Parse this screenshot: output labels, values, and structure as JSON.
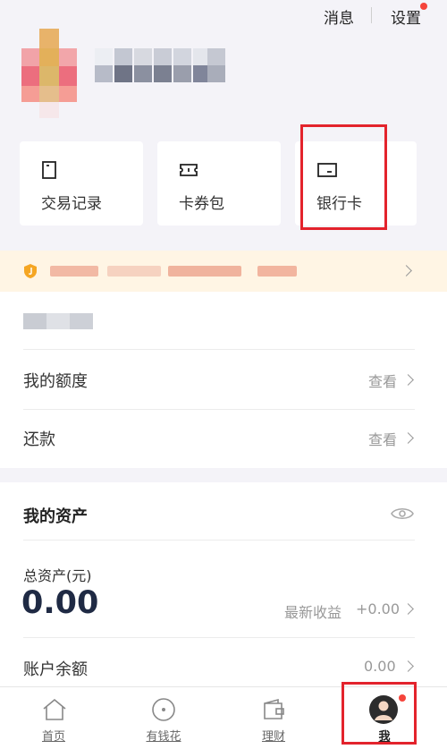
{
  "header": {
    "messages_label": "消息",
    "settings_label": "设置"
  },
  "quick_actions": [
    {
      "label": "交易记录",
      "icon": "document-icon"
    },
    {
      "label": "卡券包",
      "icon": "ticket-icon"
    },
    {
      "label": "银行卡",
      "icon": "bank-card-icon"
    }
  ],
  "quota": {
    "label": "我的额度",
    "action": "查看"
  },
  "repay": {
    "label": "还款",
    "action": "查看"
  },
  "assets": {
    "title": "我的资产",
    "total_label": "总资产(元)",
    "total_value": "0.00",
    "earnings_label": "最新收益",
    "earnings_value": "+0.00",
    "balance_label": "账户余额",
    "balance_value": "0.00"
  },
  "nav": [
    {
      "label": "首页",
      "icon": "home-icon"
    },
    {
      "label": "有钱花",
      "icon": "coin-icon"
    },
    {
      "label": "理财",
      "icon": "wallet-icon"
    },
    {
      "label": "我",
      "icon": "profile-icon",
      "active": true
    }
  ],
  "colors": {
    "highlight_box": "#e3232c",
    "badge": "#f5443b",
    "notice_bg": "#fff5e4",
    "notice_icon": "#f5a623"
  }
}
